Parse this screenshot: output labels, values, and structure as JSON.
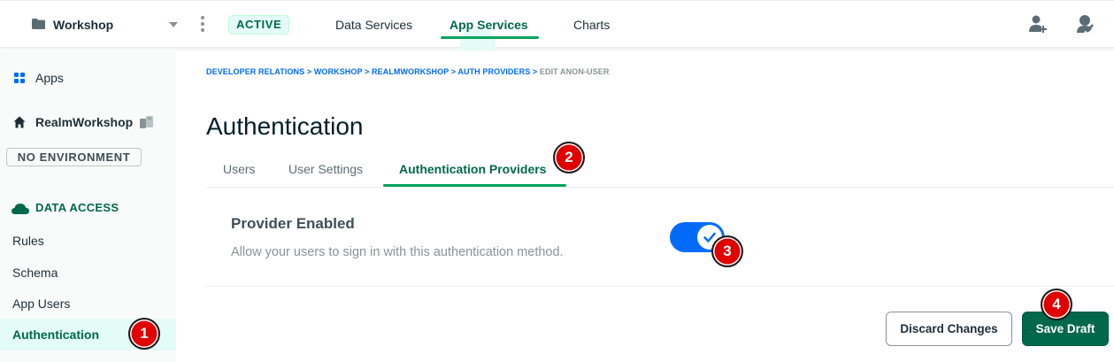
{
  "topbar": {
    "project_name": "Workshop",
    "status_badge": "ACTIVE",
    "tabs": [
      {
        "label": "Data Services"
      },
      {
        "label": "App Services"
      },
      {
        "label": "Charts"
      }
    ],
    "active_tab": "App Services"
  },
  "sidebar": {
    "apps_label": "Apps",
    "app_name": "RealmWorkshop",
    "environment": "NO ENVIRONMENT",
    "section_title": "DATA ACCESS",
    "items": [
      {
        "label": "Rules"
      },
      {
        "label": "Schema"
      },
      {
        "label": "App Users"
      },
      {
        "label": "Authentication"
      }
    ],
    "active_item": "Authentication"
  },
  "breadcrumb": {
    "items": [
      "DEVELOPER RELATIONS",
      "WORKSHOP",
      "REALMWORKSHOP",
      "AUTH PROVIDERS"
    ],
    "separator": " > ",
    "current": "EDIT ANON-USER"
  },
  "main": {
    "title": "Authentication",
    "tabs": [
      {
        "label": "Users"
      },
      {
        "label": "User Settings"
      },
      {
        "label": "Authentication Providers"
      }
    ],
    "active_tab": "Authentication Providers",
    "provider": {
      "title": "Provider Enabled",
      "description": "Allow your users to sign in with this authentication method.",
      "enabled": true
    },
    "buttons": {
      "discard": "Discard Changes",
      "save": "Save Draft"
    }
  },
  "markers": [
    "1",
    "2",
    "3",
    "4"
  ],
  "colors": {
    "brand_green": "#00684a",
    "accent_green": "#00a35c",
    "toggle_blue": "#016bf8",
    "marker_red": "#e00000"
  },
  "icons": {
    "project": "folder-icon",
    "menu": "kebab-menu-icon",
    "invite": "add-user-icon",
    "activity": "activity-feed-icon",
    "apps": "grid-icon",
    "home": "home-icon",
    "realm": "realm-app-icon",
    "data_access": "cloud-icon",
    "toggle": "checkmark-icon"
  }
}
